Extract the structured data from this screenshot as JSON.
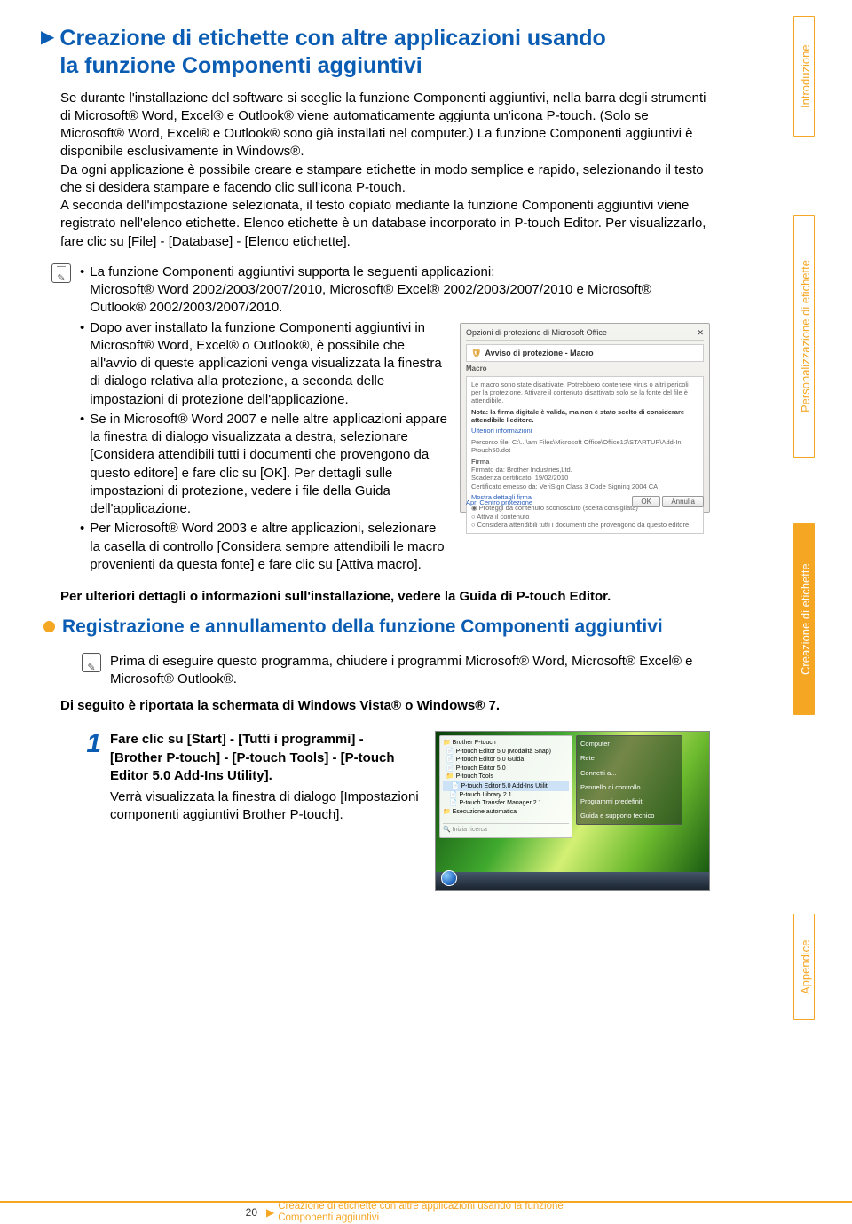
{
  "heading": {
    "title_line1": "Creazione di etichette con altre applicazioni usando",
    "title_line2": "la funzione Componenti aggiuntivi"
  },
  "intro": "Se durante l'installazione del software si sceglie la funzione Componenti aggiuntivi, nella barra degli strumenti di Microsoft® Word, Excel® e Outlook® viene automaticamente aggiunta un'icona P-touch. (Solo se Microsoft® Word, Excel® e Outlook® sono già installati nel computer.) La funzione Componenti aggiuntivi è disponibile esclusivamente in Windows®.",
  "intro2": "Da ogni applicazione è possibile creare e stampare etichette in modo semplice e rapido, selezionando il testo che si desidera stampare e facendo clic sull'icona P-touch.",
  "intro3": "A seconda dell'impostazione selezionata, il testo copiato mediante la funzione Componenti aggiuntivi viene registrato nell'elenco etichette. Elenco etichette è un database incorporato in P-touch Editor. Per visualizzarlo, fare clic su [File] - [Database] - [Elenco etichette].",
  "note1": {
    "b1a": "La funzione Componenti aggiuntivi supporta le seguenti applicazioni:",
    "b1b": "Microsoft® Word 2002/2003/2007/2010, Microsoft® Excel® 2002/2003/2007/2010 e Microsoft® Outlook® 2002/2003/2007/2010.",
    "b2a": "Dopo aver installato la funzione Componenti aggiuntivi in Microsoft® Word, Excel® o Outlook®, è possibile che all'avvio di queste applicazioni venga visualizzata la finestra di dialogo relativa alla protezione, a seconda delle impostazioni di protezione dell'applicazione.",
    "b3": "Se in Microsoft® Word 2007 e nelle altre applicazioni appare la finestra di dialogo visualizzata a destra, selezionare [Considera attendibili tutti i documenti che provengono da questo editore] e fare clic su [OK]. Per dettagli sulle impostazioni di protezione, vedere i file della Guida dell'applicazione.",
    "b4": "Per Microsoft® Word 2003 e altre applicazioni, selezionare la casella di controllo [Considera sempre attendibili le macro provenienti da questa fonte] e fare clic su [Attiva macro]."
  },
  "dialog": {
    "title": "Opzioni di protezione di Microsoft Office",
    "hdr": "Avviso di protezione - Macro",
    "sec": "Macro",
    "body1": "Le macro sono state disattivate. Potrebbero contenere virus o altri pericoli per la protezione. Attivare il contenuto disattivato solo se la fonte del file è attendibile.",
    "body2": "Nota: la firma digitale è valida, ma non è stato scelto di considerare attendibile l'editore.",
    "link": "Ulteriori informazioni",
    "path": "Percorso file:   C:\\...\\am Files\\Microsoft Office\\Office12\\STARTUP\\Add-In Ptouch50.dot",
    "firma": "Firma",
    "firmato": "Firmato da: Brother Industries,Ltd.",
    "scad": "Scadenza certificato: 19/02/2010",
    "cert": "Certificato emesso da: VeriSign Class 3 Code Signing 2004 CA",
    "mostra": "Mostra dettagli firma",
    "r1": "Proteggi da contenuto sconosciuto (scelta consigliata)",
    "r2": "Attiva il contenuto",
    "r3": "Considera attendibili tutti i documenti che provengono da questo editore",
    "flink": "Apri Centro protezione",
    "ok": "OK",
    "annulla": "Annulla"
  },
  "bold_guide": "Per ulteriori dettagli o informazioni sull'installazione, vedere la Guida di P-touch Editor.",
  "sub_heading": "Registrazione e annullamento della funzione Componenti aggiuntivi",
  "note2": "Prima di eseguire questo programma, chiudere i programmi Microsoft® Word, Microsoft® Excel® e Microsoft® Outlook®.",
  "bold_vista": "Di seguito è riportata la schermata di Windows Vista® o Windows® 7.",
  "step1": {
    "bold": "Fare clic su [Start] - [Tutti i programmi] - [Brother P-touch] - [P-touch Tools] - [P-touch Editor 5.0 Add-Ins Utility].",
    "light": "Verrà visualizzata la finestra di dialogo [Impostazioni componenti aggiuntivi Brother P-touch]."
  },
  "vista": {
    "m1": "Brother P-touch",
    "m2": "P-touch Editor 5.0 (Modalità Snap)",
    "m3": "P-touch Editor 5.0 Guida",
    "m4": "P-touch Editor 5.0",
    "m5": "P-touch Tools",
    "m6": "P-touch Editor 5.0 Add-Ins Utilit",
    "m7": "P-touch Library 2.1",
    "m8": "P-touch Transfer Manager 2.1",
    "m9": "Esecuzione automatica",
    "r1": "Computer",
    "r2": "Rete",
    "r3": "Connetti a...",
    "r4": "Pannello di controllo",
    "r5": "Programmi predefiniti",
    "r6": "Guida e supporto tecnico"
  },
  "tabs": {
    "t1": "Introduzione",
    "t2": "Personalizzazione di etichette",
    "t3": "Creazione di etichette",
    "t4": "Appendice"
  },
  "footer": {
    "page": "20",
    "line1": "Creazione di etichette con altre applicazioni usando la funzione",
    "line2": "Componenti aggiuntivi"
  }
}
